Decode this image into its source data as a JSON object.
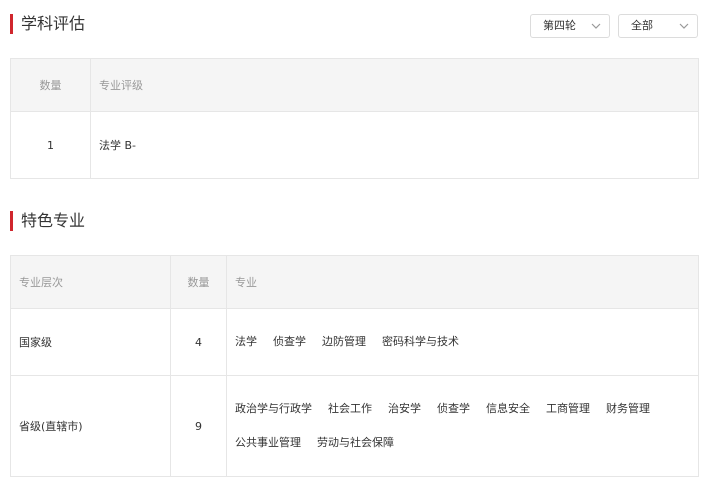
{
  "evaluation": {
    "title": "学科评估",
    "round_select": "第四轮",
    "scope_select": "全部",
    "headers": [
      "数量",
      "专业评级"
    ],
    "rows": [
      {
        "count": "1",
        "rating": "法学 B-"
      }
    ]
  },
  "featured": {
    "title": "特色专业",
    "headers": [
      "专业层次",
      "数量",
      "专业"
    ],
    "rows": [
      {
        "level": "国家级",
        "count": "4",
        "majors": [
          "法学",
          "侦查学",
          "边防管理",
          "密码科学与技术"
        ]
      },
      {
        "level": "省级(直辖市)",
        "count": "9",
        "majors": [
          "政治学与行政学",
          "社会工作",
          "治安学",
          "侦查学",
          "信息安全",
          "工商管理",
          "财务管理",
          "公共事业管理",
          "劳动与社会保障"
        ]
      }
    ]
  },
  "colors": {
    "accent": "#d0262d",
    "header_bg": "#f5f5f5",
    "border": "#e6e6e6"
  },
  "icons": {
    "select_arrow": "chevron-down-icon"
  }
}
